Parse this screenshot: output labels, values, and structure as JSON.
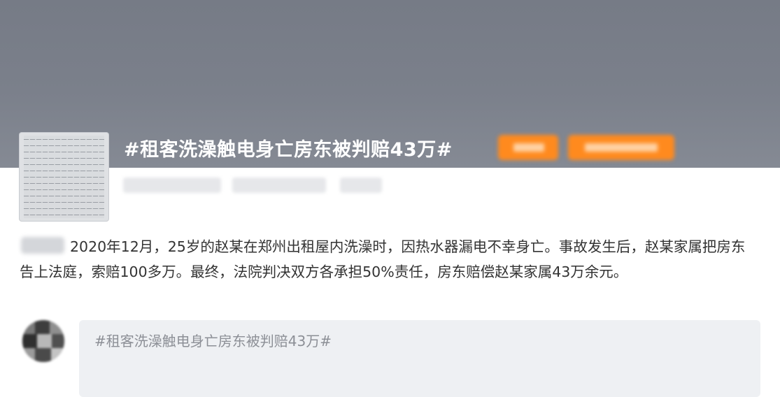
{
  "topic": {
    "title": "#租客洗澡触电身亡房东被判赔43万#"
  },
  "post": {
    "text": "2020年12月，25岁的赵某在郑州出租屋内洗澡时，因热水器漏电不幸身亡。事故发生后，赵某家属把房东告上法庭，索赔100多万。最终，法院判决双方各承担50%责任，房东赔偿赵某家属43万余元。"
  },
  "comment": {
    "input_text": "#租客洗澡触电身亡房东被判赔43万#"
  },
  "colors": {
    "hero_bg": "#7b808b",
    "tag_orange": "#ff8a1e",
    "comment_box_bg": "#eef0f3"
  }
}
